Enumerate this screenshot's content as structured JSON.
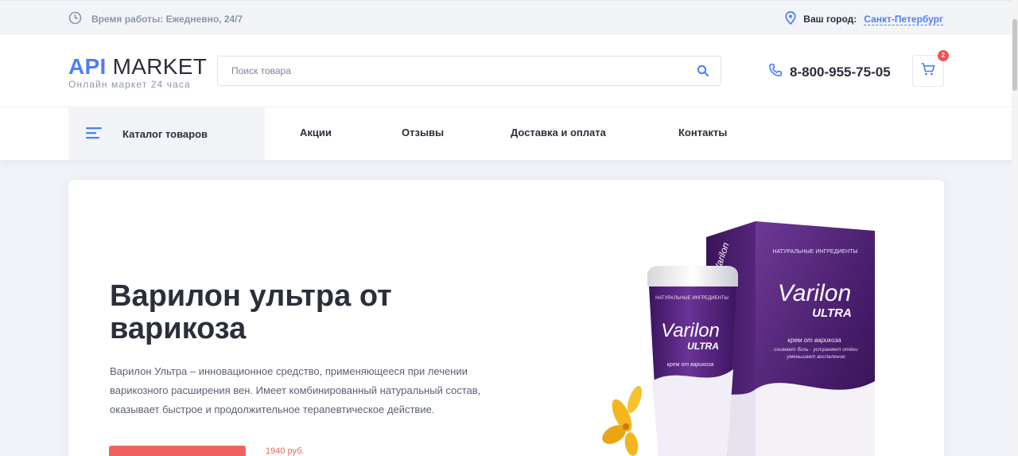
{
  "topbar": {
    "work_hours": "Время работы: Ежедневно, 24/7",
    "city_label": "Ваш город:",
    "city_value": "Санкт-Петербург"
  },
  "header": {
    "logo_api": "API",
    "logo_market": "MARKET",
    "logo_tagline": "Онлайн маркет 24 часа",
    "search_placeholder": "Поиск товара",
    "search_value": "",
    "phone": "8-800-955-75-05",
    "cart_count": "2"
  },
  "nav": {
    "catalog_label": "Каталог товаров",
    "links": [
      "Акции",
      "Отзывы",
      "Доставка и оплата",
      "Контакты"
    ]
  },
  "hero": {
    "title_bold": "Варилон ультра",
    "title_rest_1": " от",
    "title_rest_2": "варикоза",
    "description": "Варилон Ультра – инновационное средство, применяющееся при лечении варикозного расширения вен. Имеет комбинированный натуральный состав, оказывает быстрое и продолжительное терапевтическое действие.",
    "price": "1940 руб.",
    "product": {
      "box_tag": "НАТУРАЛЬНЫЕ ИНГРЕДИЕНТЫ",
      "brand": "Varilon",
      "brand_sub": "ULTRA",
      "subtitle": "крем от варикоза",
      "box_line1": "· снимает боль · устраняет отёки",
      "box_line2": "· уменьшает воспаление"
    }
  },
  "colors": {
    "accent": "#4d7ef7",
    "button": "#f06262",
    "product_purple": "#4a1f6e"
  }
}
